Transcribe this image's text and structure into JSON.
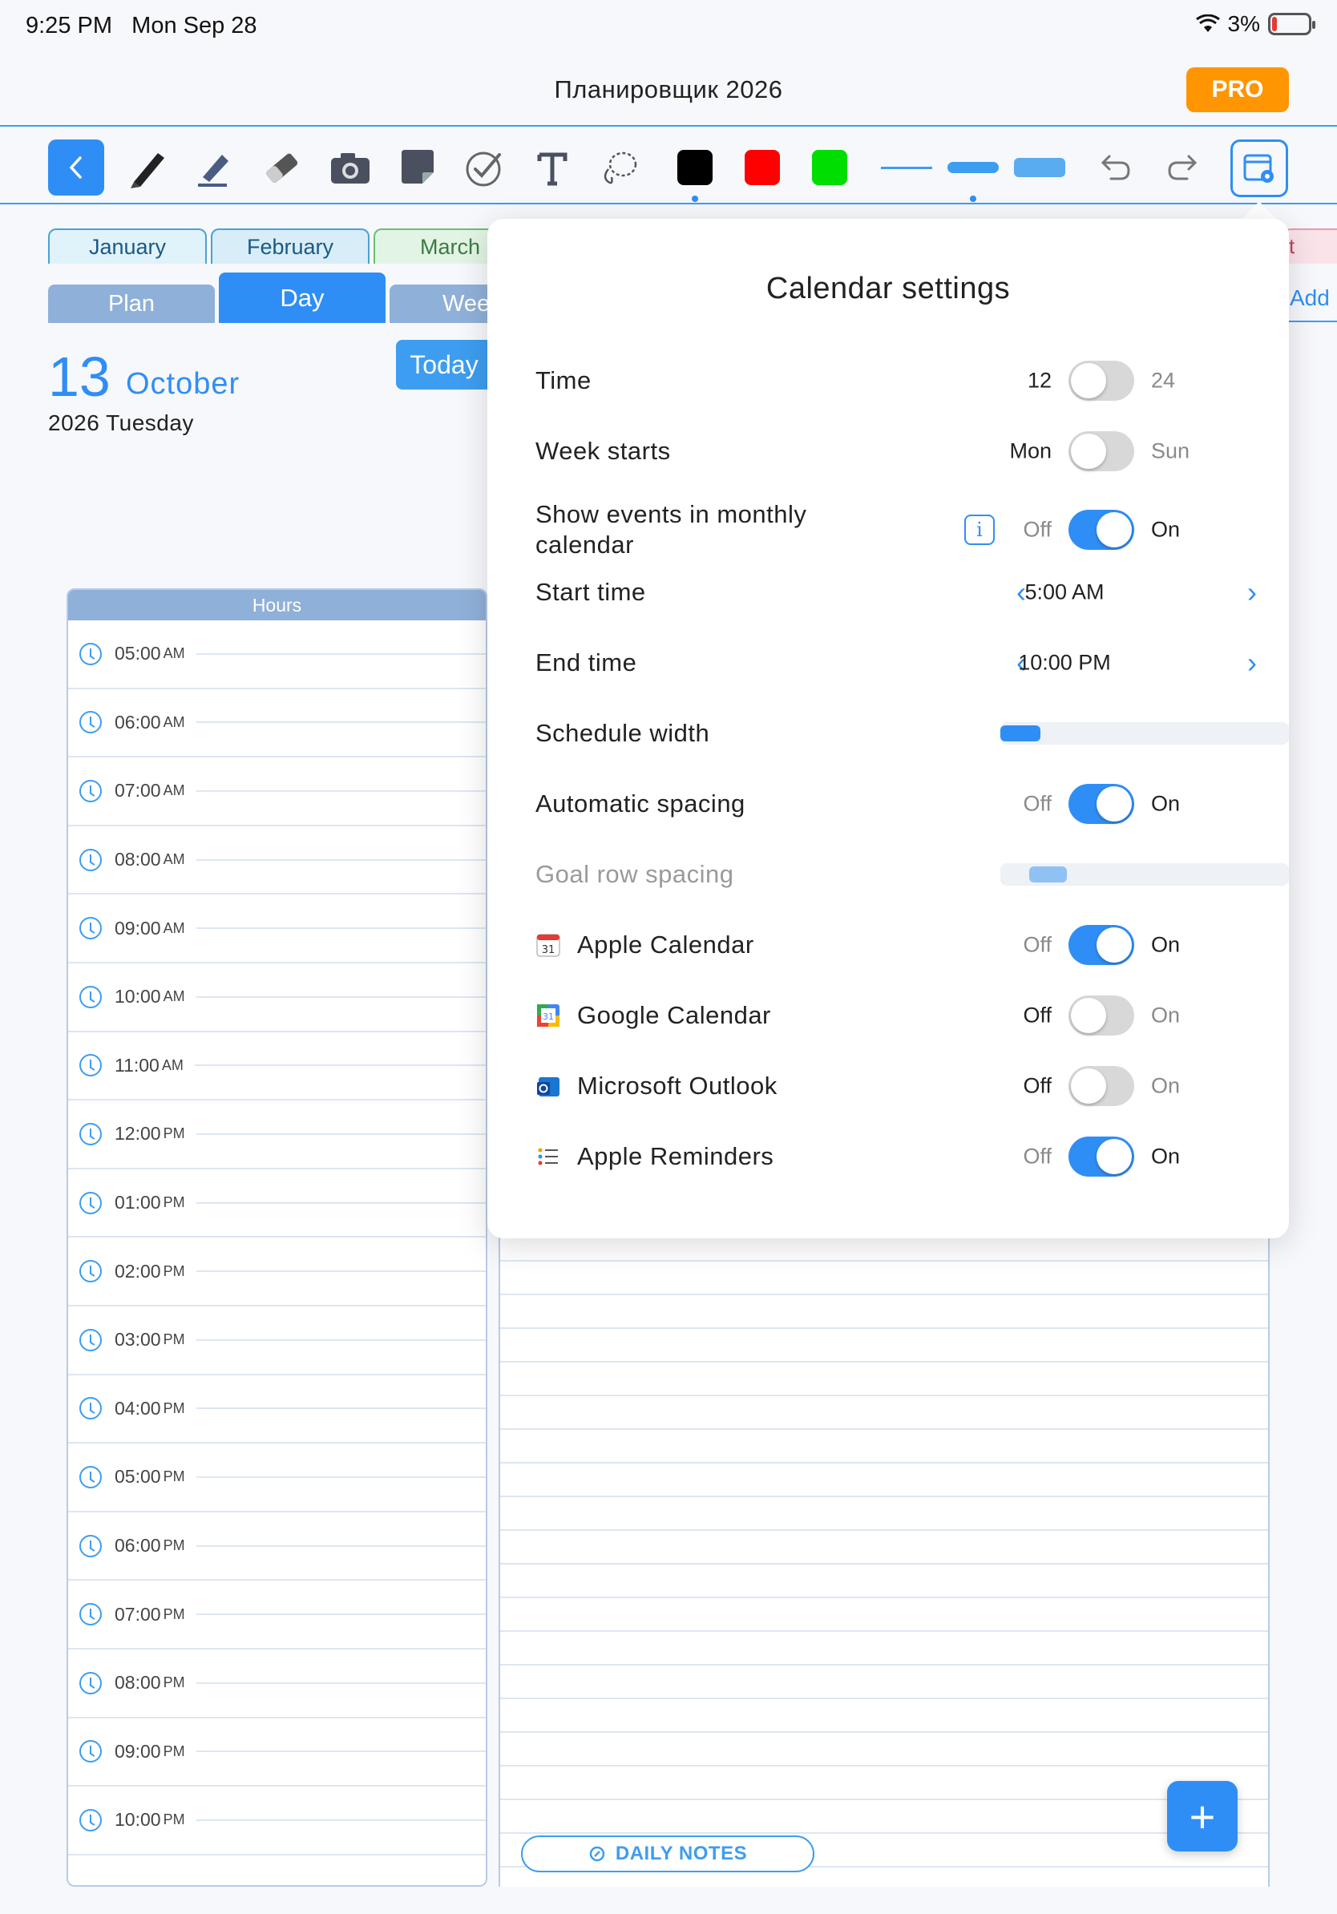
{
  "status": {
    "time": "9:25 PM",
    "date": "Mon Sep 28",
    "battery": "3%"
  },
  "app": {
    "title": "Планировщик 2026",
    "pro_label": "PRO"
  },
  "toolbar": {
    "colors": [
      "#000000",
      "#ff0000",
      "#00dd00"
    ]
  },
  "months": [
    "January",
    "February",
    "March"
  ],
  "right_tab": "t",
  "add_label": "Add",
  "views": [
    "Plan",
    "Day",
    "Wee"
  ],
  "date": {
    "day": "13",
    "month": "October",
    "sub": "2026 Tuesday",
    "today": "Today"
  },
  "hours_header": "Hours",
  "hours": [
    {
      "t": "05:00",
      "ap": "AM"
    },
    {
      "t": "06:00",
      "ap": "AM"
    },
    {
      "t": "07:00",
      "ap": "AM"
    },
    {
      "t": "08:00",
      "ap": "AM"
    },
    {
      "t": "09:00",
      "ap": "AM"
    },
    {
      "t": "10:00",
      "ap": "AM"
    },
    {
      "t": "11:00",
      "ap": "AM"
    },
    {
      "t": "12:00",
      "ap": "PM"
    },
    {
      "t": "01:00",
      "ap": "PM"
    },
    {
      "t": "02:00",
      "ap": "PM"
    },
    {
      "t": "03:00",
      "ap": "PM"
    },
    {
      "t": "04:00",
      "ap": "PM"
    },
    {
      "t": "05:00",
      "ap": "PM"
    },
    {
      "t": "06:00",
      "ap": "PM"
    },
    {
      "t": "07:00",
      "ap": "PM"
    },
    {
      "t": "08:00",
      "ap": "PM"
    },
    {
      "t": "09:00",
      "ap": "PM"
    },
    {
      "t": "10:00",
      "ap": "PM"
    }
  ],
  "daily_notes": "DAILY NOTES",
  "settings": {
    "title": "Calendar settings",
    "time": {
      "label": "Time",
      "left": "12",
      "right": "24"
    },
    "week": {
      "label": "Week starts",
      "left": "Mon",
      "right": "Sun"
    },
    "show_events": {
      "label": "Show events in monthly calendar",
      "left": "Off",
      "right": "On"
    },
    "start_time": {
      "label": "Start time",
      "value": "5:00 AM"
    },
    "end_time": {
      "label": "End time",
      "value": "10:00 PM"
    },
    "schedule_width": {
      "label": "Schedule width",
      "level": 0.14
    },
    "auto_spacing": {
      "label": "Automatic spacing",
      "left": "Off",
      "right": "On"
    },
    "goal_spacing": {
      "label": "Goal row spacing",
      "level": 0.13
    },
    "apple_cal": {
      "label": "Apple Calendar",
      "left": "Off",
      "right": "On"
    },
    "google_cal": {
      "label": "Google Calendar",
      "left": "Off",
      "right": "On"
    },
    "outlook": {
      "label": "Microsoft Outlook",
      "left": "Off",
      "right": "On"
    },
    "reminders": {
      "label": "Apple Reminders",
      "left": "Off",
      "right": "On"
    }
  }
}
